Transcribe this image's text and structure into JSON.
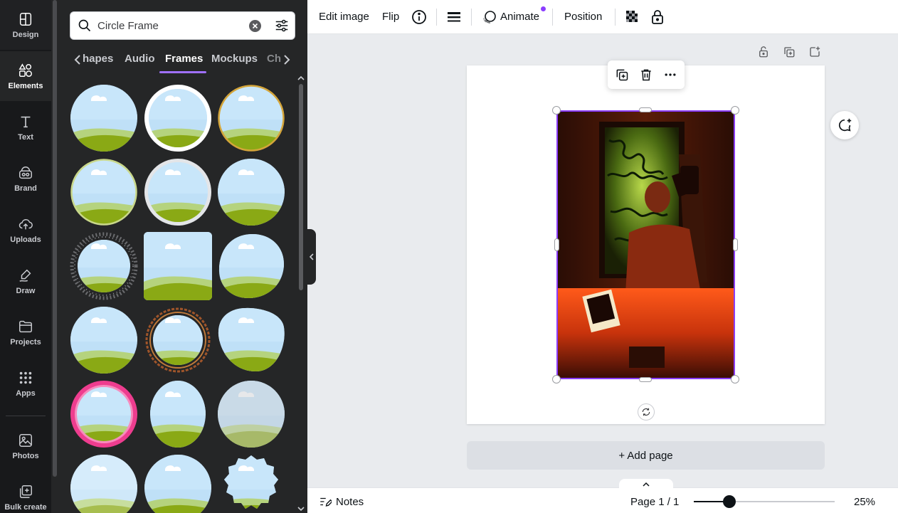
{
  "rail": {
    "items": [
      {
        "label": "Design",
        "icon": "design-icon"
      },
      {
        "label": "Elements",
        "icon": "elements-icon"
      },
      {
        "label": "Text",
        "icon": "text-icon"
      },
      {
        "label": "Brand",
        "icon": "brand-icon"
      },
      {
        "label": "Uploads",
        "icon": "cloud-upload-icon"
      },
      {
        "label": "Draw",
        "icon": "pen-icon"
      },
      {
        "label": "Projects",
        "icon": "folder-icon"
      },
      {
        "label": "Apps",
        "icon": "apps-grid-icon"
      },
      {
        "label": "Photos",
        "icon": "image-icon"
      },
      {
        "label": "Bulk create",
        "icon": "bulk-create-icon"
      }
    ],
    "active": "Elements"
  },
  "search": {
    "value": "Circle Frame",
    "placeholder": "Search elements"
  },
  "tabs": {
    "items": [
      {
        "label": "hapes"
      },
      {
        "label": "Audio"
      },
      {
        "label": "Frames"
      },
      {
        "label": "Mockups"
      },
      {
        "label": "Ch"
      }
    ],
    "active": "Frames"
  },
  "toolbar": {
    "edit_image": "Edit image",
    "flip": "Flip",
    "animate": "Animate",
    "position": "Position"
  },
  "canvas": {
    "add_page": "+ Add page"
  },
  "footer": {
    "notes": "Notes",
    "page_count": "Page 1 / 1",
    "zoom": "25%",
    "zoom_level": 0.25
  },
  "colors": {
    "accent": "#8b3dff",
    "rail_bg": "#18191b",
    "panel_bg": "#252627",
    "canvas_bg": "#e9ebee"
  }
}
